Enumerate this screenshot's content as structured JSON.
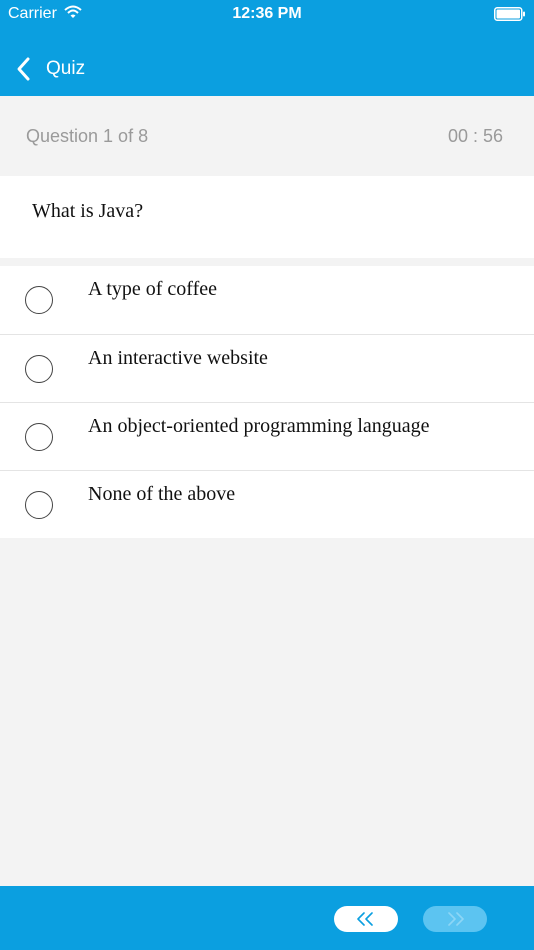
{
  "status_bar": {
    "carrier": "Carrier",
    "time": "12:36 PM"
  },
  "nav": {
    "back_label": "Quiz"
  },
  "info": {
    "question_count": "Question 1 of 8",
    "timer": "00 : 56"
  },
  "question": {
    "text": "What is Java?"
  },
  "options": [
    {
      "label": "A type of coffee"
    },
    {
      "label": "An interactive website"
    },
    {
      "label": "An object-oriented programming language"
    },
    {
      "label": "None of the above"
    }
  ],
  "colors": {
    "accent": "#0b9fe0",
    "background": "#f3f3f3",
    "muted_text": "#9a9a9a",
    "next_disabled": "#5cc4f1"
  },
  "icons": {
    "back": "chevron-left-icon",
    "prev": "double-chevron-left-icon",
    "next": "double-chevron-right-icon"
  }
}
